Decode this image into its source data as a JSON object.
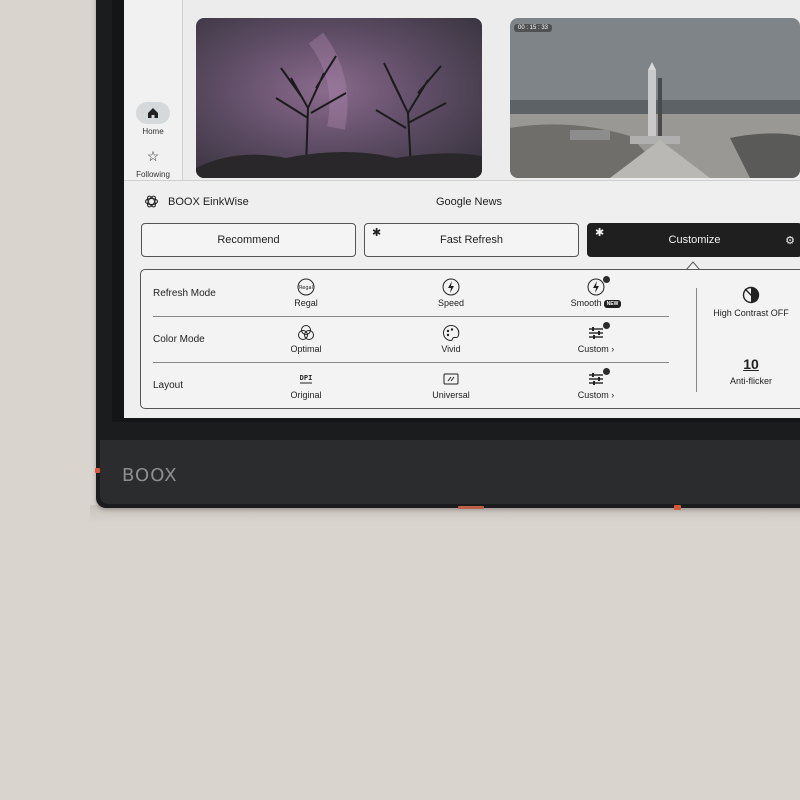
{
  "device": {
    "brand": "BOOX"
  },
  "sidebar": {
    "items": [
      {
        "label": "Home",
        "icon": "home-icon",
        "active": true
      },
      {
        "label": "Following",
        "icon": "star-icon",
        "active": false
      }
    ]
  },
  "photos": [
    {
      "subject": "aurora-trees-photo"
    },
    {
      "subject": "rocket-launch-photo",
      "overlay_time": "00 : 15 : 33"
    }
  ],
  "einkwise": {
    "title": "BOOX EinkWise",
    "app_name": "Google News",
    "modes": [
      {
        "label": "Recommend",
        "selected": false,
        "starred": false
      },
      {
        "label": "Fast Refresh",
        "selected": false,
        "starred": true
      },
      {
        "label": "Customize",
        "selected": true,
        "starred": true
      }
    ],
    "rows": [
      {
        "label": "Refresh Mode",
        "options": [
          {
            "label": "Regal",
            "icon_text": "Regal"
          },
          {
            "label": "Speed"
          },
          {
            "label": "Smooth",
            "badge": "NEW",
            "checked": true
          }
        ]
      },
      {
        "label": "Color Mode",
        "options": [
          {
            "label": "Optimal"
          },
          {
            "label": "Vivid"
          },
          {
            "label": "Custom",
            "chevron": "›",
            "checked": true
          }
        ]
      },
      {
        "label": "Layout",
        "options": [
          {
            "label": "Original",
            "icon_text": "DPI"
          },
          {
            "label": "Universal"
          },
          {
            "label": "Custom",
            "chevron": "›",
            "checked": true
          }
        ]
      }
    ],
    "high_contrast": {
      "label": "High Contrast OFF"
    },
    "anti_flicker": {
      "value": "10",
      "label": "Anti-flicker"
    }
  },
  "colors": {
    "accent": "#d8583a",
    "panel": "#efefef",
    "dark_button": "#1f1f1f"
  }
}
